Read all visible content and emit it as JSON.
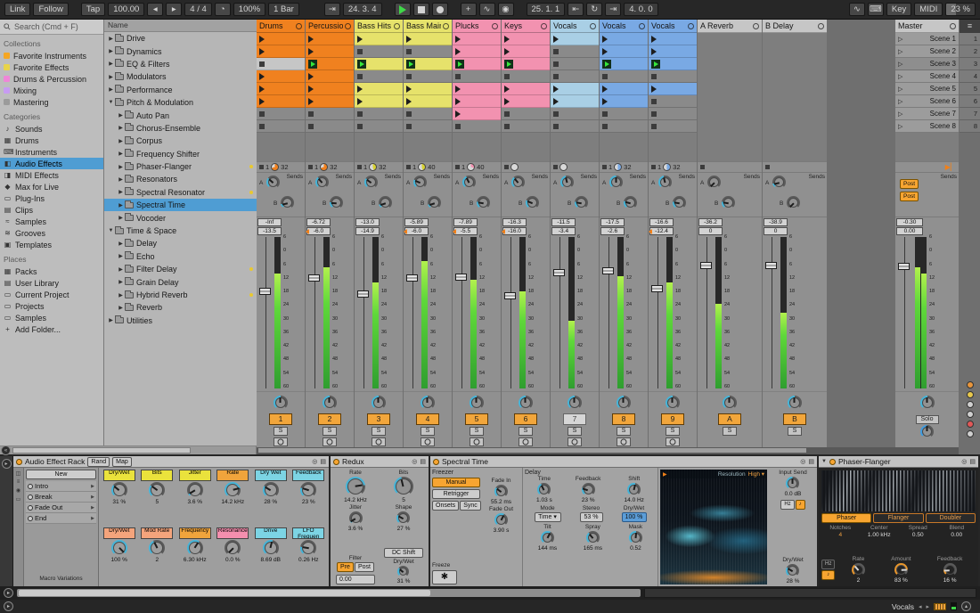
{
  "toolbar": {
    "link": "Link",
    "follow": "Follow",
    "tap": "Tap",
    "tempo": "100.00",
    "time_sig": "4 / 4",
    "groove": "100%",
    "quantize": "1 Bar",
    "position": "24. 3. 4",
    "loop_start": "25. 1. 1",
    "loop_length": "4. 0. 0",
    "key_label": "Key",
    "midi_label": "MIDI",
    "cpu": "23 %"
  },
  "browser": {
    "search_placeholder": "Search (Cmd + F)",
    "collections_title": "Collections",
    "collections": [
      {
        "label": "Favorite Instruments",
        "color": "#f5a623"
      },
      {
        "label": "Favorite Effects",
        "color": "#e8d44a"
      },
      {
        "label": "Drums & Percussion",
        "color": "#ef86d8"
      },
      {
        "label": "Mixing",
        "color": "#c79bf2"
      },
      {
        "label": "Mastering",
        "color": "#9b9b9b"
      }
    ],
    "categories_title": "Categories",
    "categories": [
      {
        "label": "Sounds",
        "icon": "♪"
      },
      {
        "label": "Drums",
        "icon": "▦"
      },
      {
        "label": "Instruments",
        "icon": "⌨"
      },
      {
        "label": "Audio Effects",
        "icon": "◧",
        "selected": true
      },
      {
        "label": "MIDI Effects",
        "icon": "◨"
      },
      {
        "label": "Max for Live",
        "icon": "◆"
      },
      {
        "label": "Plug-Ins",
        "icon": "▭"
      },
      {
        "label": "Clips",
        "icon": "▤"
      },
      {
        "label": "Samples",
        "icon": "≈"
      },
      {
        "label": "Grooves",
        "icon": "≋"
      },
      {
        "label": "Templates",
        "icon": "▣"
      }
    ],
    "places_title": "Places",
    "places": [
      {
        "label": "Packs",
        "icon": "▦"
      },
      {
        "label": "User Library",
        "icon": "▤"
      },
      {
        "label": "Current Project",
        "icon": "▭"
      },
      {
        "label": "Projects",
        "icon": "▭"
      },
      {
        "label": "Samples",
        "icon": "▭"
      },
      {
        "label": "Add Folder...",
        "icon": "+"
      }
    ],
    "tree_header": "Name",
    "tree": [
      {
        "label": "Drive",
        "depth": 0,
        "arrow": "collapsed"
      },
      {
        "label": "Dynamics",
        "depth": 0,
        "arrow": "collapsed"
      },
      {
        "label": "EQ & Filters",
        "depth": 0,
        "arrow": "collapsed"
      },
      {
        "label": "Modulators",
        "depth": 0,
        "arrow": "collapsed"
      },
      {
        "label": "Performance",
        "depth": 0,
        "arrow": "collapsed"
      },
      {
        "label": "Pitch & Modulation",
        "depth": 0,
        "arrow": "expanded"
      },
      {
        "label": "Auto Pan",
        "depth": 1,
        "arrow": "collapsed"
      },
      {
        "label": "Chorus-Ensemble",
        "depth": 1,
        "arrow": "collapsed"
      },
      {
        "label": "Corpus",
        "depth": 1,
        "arrow": "collapsed"
      },
      {
        "label": "Frequency Shifter",
        "depth": 1,
        "arrow": "collapsed"
      },
      {
        "label": "Phaser-Flanger",
        "depth": 1,
        "arrow": "collapsed",
        "dot": true
      },
      {
        "label": "Resonators",
        "depth": 1,
        "arrow": "collapsed"
      },
      {
        "label": "Spectral Resonator",
        "depth": 1,
        "arrow": "collapsed",
        "dot": true
      },
      {
        "label": "Spectral Time",
        "depth": 1,
        "arrow": "collapsed",
        "selected": true
      },
      {
        "label": "Vocoder",
        "depth": 1,
        "arrow": "collapsed"
      },
      {
        "label": "Time & Space",
        "depth": 0,
        "arrow": "expanded"
      },
      {
        "label": "Delay",
        "depth": 1,
        "arrow": "collapsed"
      },
      {
        "label": "Echo",
        "depth": 1,
        "arrow": "collapsed"
      },
      {
        "label": "Filter Delay",
        "depth": 1,
        "arrow": "collapsed",
        "dot": true
      },
      {
        "label": "Grain Delay",
        "depth": 1,
        "arrow": "collapsed"
      },
      {
        "label": "Hybrid Reverb",
        "depth": 1,
        "arrow": "collapsed",
        "dot": true
      },
      {
        "label": "Reverb",
        "depth": 1,
        "arrow": "collapsed"
      },
      {
        "label": "Utilities",
        "depth": 0,
        "arrow": "collapsed"
      }
    ]
  },
  "session": {
    "db_scale": [
      "6",
      "0",
      "6",
      "12",
      "18",
      "24",
      "30",
      "36",
      "42",
      "48",
      "54",
      "60"
    ],
    "sends_label": "Sends",
    "post_label": "Post",
    "solo_label": "Solo",
    "scenes": [
      "Scene 1",
      "Scene 2",
      "Scene 3",
      "Scene 4",
      "Scene 5",
      "Scene 6",
      "Scene 7",
      "Scene 8"
    ],
    "scene_numbers": [
      "1",
      "2",
      "3",
      "4",
      "5",
      "6",
      "7",
      "8"
    ],
    "tracks": [
      {
        "name": "Drums",
        "kind": "audio",
        "color": "#f0811f",
        "slots": "cchcccss",
        "status": {
          "bars": "1",
          "length": "32",
          "pie": 0.7,
          "pie_color": "#f0811f"
        },
        "sends": [
          0.32,
          0.12
        ],
        "peak_db": "-Inf",
        "volume_db": "-13.5",
        "marker": false,
        "fader": 0.35,
        "meter": 0.76,
        "number": "1",
        "active": true
      },
      {
        "name": "Percussion",
        "kind": "audio",
        "color": "#f0811f",
        "slots": "ccpcccss",
        "status": {
          "bars": "1",
          "length": "32",
          "pie": 0.7,
          "pie_color": "#f0811f"
        },
        "sends": [
          0.35,
          0.18
        ],
        "peak_db": "-6.72",
        "volume_db": "-6.0",
        "marker": true,
        "fader": 0.26,
        "meter": 0.8,
        "number": "2",
        "active": true
      },
      {
        "name": "Bass Hits",
        "kind": "audio",
        "color": "#e6e26b",
        "slots": "cspsccss",
        "status": {
          "bars": "1",
          "length": "32",
          "pie": 0.45,
          "pie_color": "#d8d232"
        },
        "sends": [
          0.3,
          0.1
        ],
        "peak_db": "-13.0",
        "volume_db": "-14.9",
        "marker": false,
        "fader": 0.37,
        "meter": 0.7,
        "number": "3",
        "active": true
      },
      {
        "name": "Bass Main",
        "kind": "audio",
        "color": "#e6e26b",
        "slots": "cspsccss",
        "status": {
          "bars": "1",
          "length": "40",
          "pie": 0.45,
          "pie_color": "#d8d232"
        },
        "sends": [
          0.25,
          0.1
        ],
        "peak_db": "-5.89",
        "volume_db": "-6.0",
        "marker": true,
        "fader": 0.26,
        "meter": 0.84,
        "number": "4",
        "active": true
      },
      {
        "name": "Plucks",
        "kind": "audio",
        "color": "#f292b0",
        "slots": "ccpscccs",
        "status": {
          "bars": "1",
          "length": "40",
          "pie": 0.3,
          "pie_color": "#f292b0"
        },
        "sends": [
          0.4,
          0.2
        ],
        "peak_db": "-7.89",
        "volume_db": "-5.5",
        "marker": true,
        "fader": 0.25,
        "meter": 0.72,
        "number": "5",
        "active": true
      },
      {
        "name": "Keys",
        "kind": "audio",
        "color": "#f292b0",
        "slots": "ccpsccss",
        "status": {
          "pie": 0.0,
          "pie_color": "#a8a8a8"
        },
        "sends": [
          0.35,
          0.25
        ],
        "peak_db": "-16.3",
        "volume_db": "-16.0",
        "marker": true,
        "fader": 0.38,
        "meter": 0.64,
        "number": "6",
        "active": true
      },
      {
        "name": "Vocals",
        "kind": "audio",
        "color": "#a9cfe5",
        "slots": "csssccss",
        "status": {
          "pie": 0.0,
          "pie_color": "#a8a8a8"
        },
        "sends": [
          0.45,
          0.2
        ],
        "peak_db": "-11.5",
        "volume_db": "-3.4",
        "marker": false,
        "fader": 0.22,
        "meter": 0.45,
        "number": "7",
        "active": false
      },
      {
        "name": "Vocals",
        "kind": "audio",
        "color": "#79a9e4",
        "slots": "ccpsccss",
        "status": {
          "bars": "1",
          "length": "32",
          "pie": 0.5,
          "pie_color": "#79a9e4"
        },
        "sends": [
          0.5,
          0.22
        ],
        "peak_db": "-17.5",
        "volume_db": "-2.6",
        "marker": false,
        "fader": 0.21,
        "meter": 0.74,
        "number": "8",
        "active": true
      },
      {
        "name": "Vocals",
        "kind": "audio",
        "color": "#79a9e4",
        "slots": "ccpscsss",
        "status": {
          "bars": "1",
          "length": "32",
          "pie": 0.5,
          "pie_color": "#79a9e4"
        },
        "sends": [
          0.45,
          0.2
        ],
        "peak_db": "-16.6",
        "volume_db": "-12.4",
        "marker": true,
        "fader": 0.33,
        "meter": 0.7,
        "number": "9",
        "active": true
      },
      {
        "name": "A Reverb",
        "kind": "return",
        "color": "#c6c6c6",
        "sends": [
          0.0,
          0.2
        ],
        "peak_db": "-36.2",
        "volume_db": "0",
        "marker": false,
        "fader": 0.17,
        "meter": 0.56,
        "number": "A",
        "active": true
      },
      {
        "name": "B Delay",
        "kind": "return",
        "color": "#c6c6c6",
        "sends": [
          0.12,
          0.0
        ],
        "peak_db": "-38.9",
        "volume_db": "0",
        "marker": false,
        "fader": 0.17,
        "meter": 0.5,
        "number": "B",
        "active": true
      },
      {
        "name": "Master",
        "kind": "master",
        "color": "#c6c6c6",
        "peak_db": "-0.30",
        "volume_db": "0.00",
        "fader": 0.18,
        "meter": 0.8
      }
    ]
  },
  "devices": {
    "rack": {
      "title": "Audio Effect Rack",
      "rand_label": "Rand",
      "map_label": "Map",
      "new_label": "New",
      "chains": [
        "Intro",
        "Break",
        "Fade Out",
        "End"
      ],
      "macro_variations_label": "Macro Variations",
      "macros": [
        {
          "label": "Dry/Wet",
          "value": "31 %",
          "color": "#eae23c",
          "amount": 0.31
        },
        {
          "label": "Bits",
          "value": "5",
          "color": "#eae23c",
          "amount": 0.3
        },
        {
          "label": "Jitter",
          "value": "3.6 %",
          "color": "#eae23c",
          "amount": 0.05
        },
        {
          "label": "Rate",
          "value": "14.2 kHz",
          "color": "#f0a43c",
          "amount": 0.78
        },
        {
          "label": "Dry Wet",
          "value": "28 %",
          "color": "#7cd4e4",
          "amount": 0.28
        },
        {
          "label": "Feedback",
          "value": "23 %",
          "color": "#7cd4e4",
          "amount": 0.23
        },
        {
          "label": "Dry/Wet",
          "value": "100 %",
          "color": "#f4a47c",
          "amount": 1
        },
        {
          "label": "Mod Rate",
          "value": "2",
          "color": "#f4a47c",
          "amount": 0.4
        },
        {
          "label": "Frequency",
          "value": "6.30 kHz",
          "color": "#f0a43c",
          "amount": 0.62
        },
        {
          "label": "Resonance",
          "value": "0.0 %",
          "color": "#f48fae",
          "amount": 0
        },
        {
          "label": "Drive",
          "value": "8.69 dB",
          "color": "#7cd4e4",
          "amount": 0.55
        },
        {
          "label": "LFO Frequen",
          "value": "0.26 Hz",
          "color": "#7cd4e4",
          "amount": 0.2
        }
      ]
    },
    "redux": {
      "title": "Redux",
      "rate_label": "Rate",
      "rate": "14.2 kHz",
      "rate_amount": 0.8,
      "jitter_label": "Jitter",
      "jitter": "3.6 %",
      "jitter_amount": 0.05,
      "bits_label": "Bits",
      "bits": "5",
      "bits_amount": 0.45,
      "shape_label": "Shape",
      "shape": "27 %",
      "shape_amount": 0.27,
      "filter_label": "Filter",
      "pre_label": "Pre",
      "post_label": "Post",
      "filter_freq": "0.00",
      "dc_shift_label": "DC Shift",
      "drywet_label": "Dry/Wet",
      "drywet": "31 %",
      "drywet_amount": 0.31
    },
    "spectral_time": {
      "title": "Spectral Time",
      "freezer_label": "Freezer",
      "manual_label": "Manual",
      "retrigger_label": "Retrigger",
      "onsets_label": "Onsets",
      "sync_label": "Sync",
      "fade_in_label": "Fade In",
      "fade_in": "55.2 ms",
      "fade_in_amount": 0.3,
      "fade_out_label": "Fade Out",
      "fade_out": "3.90 s",
      "fade_out_amount": 0.6,
      "freeze_label": "Freeze",
      "delay_label": "Delay",
      "time_label": "Time",
      "time": "1.03 s",
      "time_amount": 0.4,
      "feedback_label": "Feedback",
      "feedback": "23 %",
      "feedback_amount": 0.23,
      "shift_label": "Shift",
      "shift": "14.0 Hz",
      "shift_amount": 0.55,
      "mode_label": "Mode",
      "mode": "Time",
      "stereo_label": "Stereo",
      "stereo": "53 %",
      "delay_drywet_label": "Dry/Wet",
      "delay_drywet": "100 %",
      "tilt_label": "Tilt",
      "tilt": "144 ms",
      "tilt_amount": 0.6,
      "spray_label": "Spray",
      "spray": "165 ms",
      "spray_amount": 0.35,
      "mask_label": "Mask",
      "mask": "0.52",
      "mask_amount": 0.52,
      "resolution_label": "Resolution",
      "resolution": "High",
      "input_send_label": "Input Send",
      "input_send": "0.0 dB",
      "input_send_amount": 0.5,
      "hz_label": "Hz",
      "note_label": "♪",
      "drywet_label": "Dry/Wet",
      "drywet": "28 %",
      "drywet_amount": 0.28
    },
    "phaser": {
      "title": "Phaser-Flanger",
      "tabs": [
        "Phaser",
        "Flanger",
        "Doubler"
      ],
      "notches_label": "Notches",
      "notches": "4",
      "center_label": "Center",
      "center": "1.00 kHz",
      "spread_label": "Spread",
      "spread": "0.50",
      "blend_label": "Blend",
      "blend": "0.00",
      "hz_label": "Hz",
      "note_label": "♪",
      "rate_label": "Rate",
      "rate": "2",
      "rate_amount": 0.35,
      "amount_label": "Amount",
      "amount": "83 %",
      "amount_amount": 0.83,
      "feedback_label": "Feedback",
      "feedback": "16 %",
      "feedback_amount": 0.16
    }
  },
  "status_bar": {
    "selected_track": "Vocals"
  }
}
